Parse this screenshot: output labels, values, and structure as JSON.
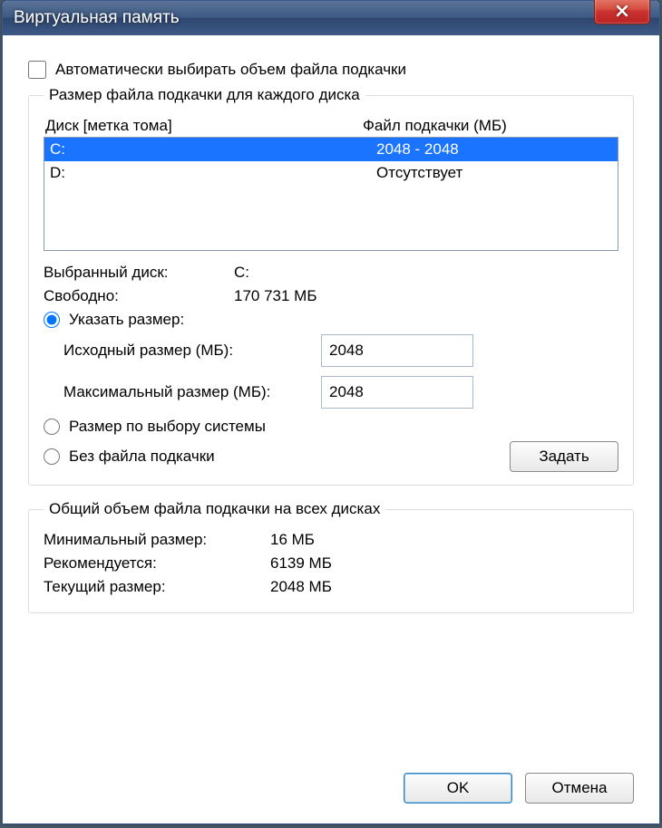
{
  "title": "Виртуальная память",
  "auto_checkbox_label": "Автоматически выбирать объем файла подкачки",
  "group1_title": "Размер файла подкачки для каждого диска",
  "col_disk": "Диск [метка тома]",
  "col_pf": "Файл подкачки (МБ)",
  "rows": [
    {
      "disk": "C:",
      "pf": "2048 - 2048",
      "selected": true
    },
    {
      "disk": "D:",
      "pf": "Отсутствует",
      "selected": false
    }
  ],
  "selected_disk_label": "Выбранный диск:",
  "selected_disk_value": "C:",
  "free_label": "Свободно:",
  "free_value": "170 731 МБ",
  "opt_custom": "Указать размер:",
  "initial_label": "Исходный размер (МБ):",
  "initial_value": "2048",
  "max_label": "Максимальный размер (МБ):",
  "max_value": "2048",
  "opt_system": "Размер по выбору системы",
  "opt_none": "Без файла подкачки",
  "btn_set": "Задать",
  "group2_title": "Общий объем файла подкачки на всех дисках",
  "min_label": "Минимальный размер:",
  "min_value": "16 МБ",
  "rec_label": "Рекомендуется:",
  "rec_value": "6139 МБ",
  "cur_label": "Текущий размер:",
  "cur_value": "2048 МБ",
  "btn_ok": "OK",
  "btn_cancel": "Отмена"
}
